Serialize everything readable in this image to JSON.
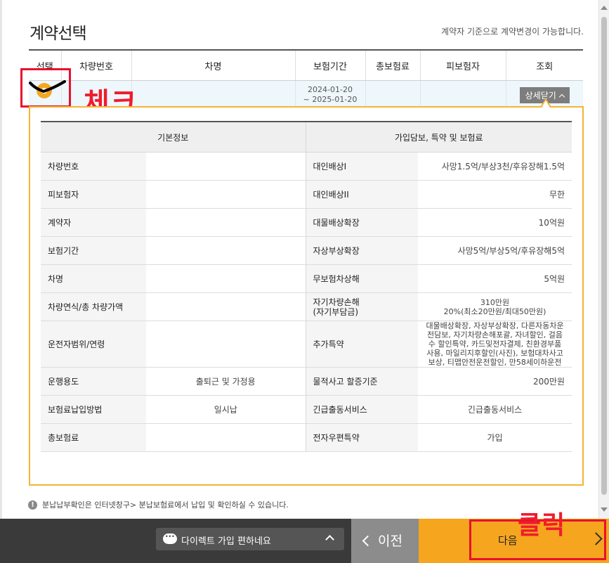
{
  "header": {
    "title": "계약선택",
    "notice": "계약자 기준으로 계약변경이 가능합니다."
  },
  "contract_table": {
    "columns": [
      "선택",
      "차량번호",
      "차명",
      "보험기간",
      "총보험료",
      "피보험자",
      "조회"
    ],
    "row": {
      "vehicle_number": "",
      "car_name": "",
      "period_start": "2024-01-20",
      "period_end": "~ 2025-01-20",
      "total_premium": "",
      "insured": "",
      "detail_button": "상세닫기"
    }
  },
  "detail": {
    "headers": [
      "기본정보",
      "가입담보, 특약 및 보험료"
    ],
    "rows": [
      {
        "l1": "차량번호",
        "v1": "",
        "l2": "대인배상I",
        "v2": "사망1.5억/부상3천/후유장해1.5억"
      },
      {
        "l1": "피보험자",
        "v1": "",
        "l2": "대인배상II",
        "v2": "무한"
      },
      {
        "l1": "계약자",
        "v1": "",
        "l2": "대물배상확장",
        "v2": "10억원"
      },
      {
        "l1": "보험기간",
        "v1": "",
        "l2": "자상부상확장",
        "v2": "사망5억/부상5억/후유장해5억"
      },
      {
        "l1": "차명",
        "v1": "",
        "l2": "무보험차상해",
        "v2": "5억원"
      },
      {
        "l1": "차량연식/총 차량가액",
        "v1": "",
        "l2": "자기차량손해\n(자기부담금)",
        "v2a": "310만원",
        "v2b": "20%(최소20만원/최대50만원)"
      },
      {
        "l1": "운전자범위/연령",
        "v1": "",
        "l2": "추가특약",
        "v2": "대물배상확장, 자상부상확장, 다른자동차운전담보, 자기차량손해포괄, 자녀할인, 걸음수 할인특약, 카드및전자결제, 친환경부품사용, 마일리지후할인(사진), 보험대차사고보상, 티맵안전운전할인, 만58세이하운전"
      },
      {
        "l1": "운행용도",
        "v1": "출퇴근 및 가정용",
        "l2": "물적사고 할증기준",
        "v2": "200만원"
      },
      {
        "l1": "보험료납입방법",
        "v1": "일시납",
        "l2": "긴급출동서비스",
        "v2": "긴급출동서비스"
      },
      {
        "l1": "총보험료",
        "v1": "",
        "l2": "전자우편특약",
        "v2": "가입"
      }
    ]
  },
  "notes": [
    "분납납부확인은 인터넷창구> 분납보험료에서 납입 및 확인하실 수 있습니다."
  ],
  "bottom_bar": {
    "chat_label": "다이렉트 가입 편하네요",
    "prev_label": "이전",
    "next_label": "다음"
  },
  "annotations": {
    "check_label": "체크",
    "click_label": "클릭"
  },
  "colors": {
    "accent": "#f6a51e",
    "annotation_red": "#e8112d",
    "row_highlight": "#eef7fb"
  }
}
